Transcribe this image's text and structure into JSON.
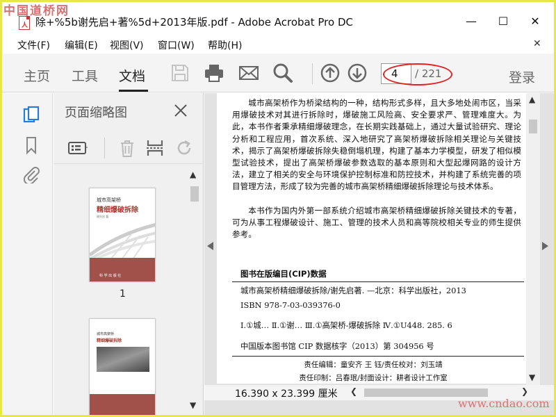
{
  "watermarks": {
    "top": "中国道桥网",
    "bottom": "www.cndao.com"
  },
  "window": {
    "title": "除+%5b谢先启+著%5d+2013年版.pdf - Adobe Acrobat Pro DC",
    "minimize": "—",
    "maximize": "☐",
    "close": "✕"
  },
  "menu": {
    "items": [
      "文件(F)",
      "编辑(E)",
      "视图(V)",
      "窗口(W)",
      "帮助(H)"
    ],
    "close": "✕"
  },
  "toolbar": {
    "tabs": [
      "主页",
      "工具",
      "文档"
    ],
    "active_tab": "文档",
    "current_page": "4",
    "total_pages": "/ 221",
    "login": "登录",
    "accent_color": "#e22222"
  },
  "panel": {
    "title": "页面缩略图",
    "thumb_label": "1",
    "thumb1": {
      "line1": "城市高架桥",
      "line2": "精细爆破拆除",
      "author": "谢先启 著",
      "publisher": "科 学 出 版 社"
    },
    "thumb2": {
      "line1": "城市高架桥",
      "line2": "精细爆破拆除"
    }
  },
  "document": {
    "paragraph1": "城市高架桥作为桥梁结构的一种，结构形式多样，且大多地处闹市区，当采用爆破技术对其进行拆除时，爆破施工风险高、安全要求严、管理难度大。为此，本书作者秉承精细爆破理念，在长期实践基础上，通过大量试验研究、理论分析和工程应用，首次系统、深入地研究了高架桥爆破拆除相关理论与关键技术，揭示了高架桥爆破拆除失稳倒塌机理，构建了基本力学模型，研发了相似模型试验技术，提出了高架桥爆破参数选取的基本原则和大型起爆网路的设计方法，建立了相关的安全与环境保护控制标准和防控技术，并构建了系统完善的项目管理方法，形成了较为完善的城市高架桥精细爆破拆除理论与技术体系。",
    "paragraph2": "本书作为国内外第一部系统介绍城市高架桥精细爆破拆除关键技术的专著，可为从事工程爆破设计、施工、管理的技术人员和高等院校相关专业的师生提供参考。",
    "cip_title": "图书在版编目(CIP)数据",
    "cip_line1": "城市高架桥精细爆破拆除/谢先启著. —北京：科学出版社，2013",
    "cip_line2": "ISBN 978-7-03-039376-0",
    "cip_line3": "Ⅰ.①城…   Ⅱ.①谢…   Ⅲ.①高架桥-爆破拆除   Ⅳ.①U448. 285. 6",
    "cip_line4": "中国版本图书馆 CIP 数据核字（2013）第 304956 号",
    "credits1": "责任编辑：童安齐   王  钰/责任校对：刘玉靖",
    "credits2": "责任印制：吕春珉/封面设计：耕者设计工作室"
  },
  "status": {
    "page_size": "16.390 x 23.399 厘米"
  }
}
